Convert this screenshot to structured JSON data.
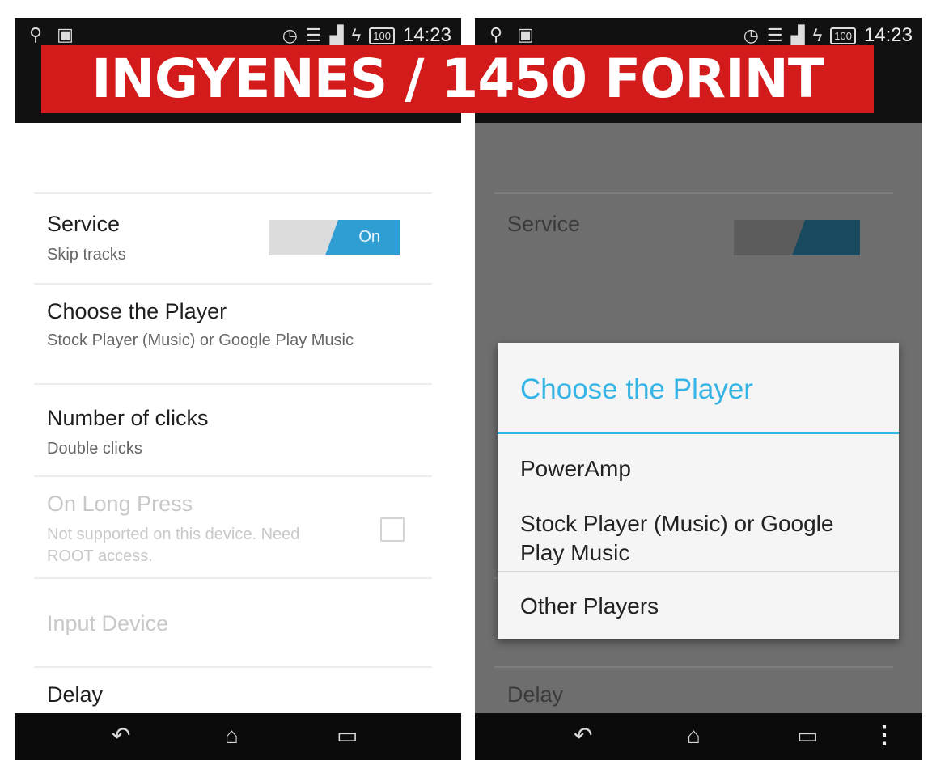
{
  "banner": {
    "text": "INGYENES / 1450 FORINT"
  },
  "status_bar": {
    "time": "14:23",
    "battery": "100"
  },
  "settings": {
    "service": {
      "title": "Service",
      "subtitle": "Skip tracks",
      "toggle_label": "On"
    },
    "choose_player": {
      "title": "Choose the Player",
      "subtitle": "Stock Player (Music) or Google Play Music"
    },
    "number_of_clicks": {
      "title": "Number of clicks",
      "subtitle": "Double clicks"
    },
    "long_press": {
      "title": "On Long Press",
      "subtitle": "Not supported on this device. Need ROOT access."
    },
    "input_device": {
      "title": "Input Device"
    },
    "delay": {
      "title": "Delay"
    }
  },
  "dialog": {
    "title": "Choose the Player",
    "options": [
      "PowerAmp",
      "Stock Player (Music) or Google Play Music",
      "Other Players"
    ]
  },
  "nav": {
    "back": "back-icon",
    "home": "home-icon",
    "recents": "recents-icon",
    "menu": "overflow-menu-icon"
  },
  "colors": {
    "accent": "#35b5e5",
    "banner": "#d41b1b",
    "toggle_on": "#2f9fd3"
  }
}
